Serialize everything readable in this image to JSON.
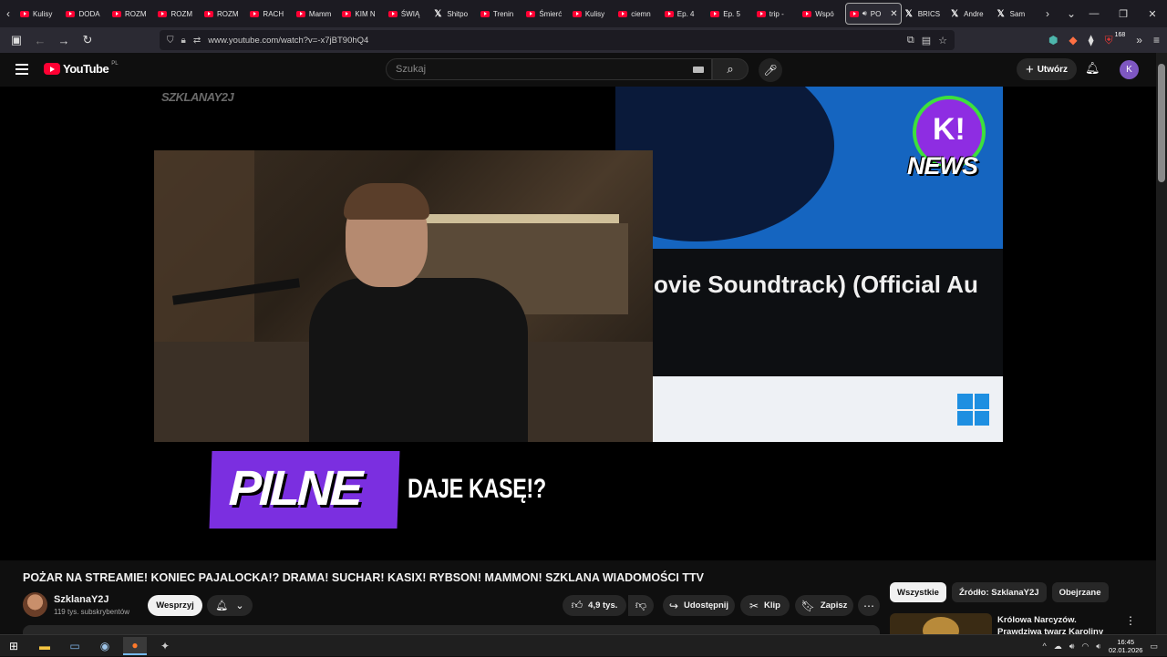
{
  "browser": {
    "tabs": [
      {
        "label": "Kulisy",
        "icon": "youtube-icon"
      },
      {
        "label": "DODA",
        "icon": "youtube-icon"
      },
      {
        "label": "ROZM",
        "icon": "youtube-icon"
      },
      {
        "label": "ROZM",
        "icon": "youtube-icon"
      },
      {
        "label": "ROZM",
        "icon": "youtube-icon"
      },
      {
        "label": "RACH",
        "icon": "youtube-icon"
      },
      {
        "label": "Mamm",
        "icon": "youtube-icon"
      },
      {
        "label": "KIM N",
        "icon": "youtube-icon"
      },
      {
        "label": "ŚWIĄ",
        "icon": "youtube-icon"
      },
      {
        "label": "Shitpo",
        "icon": "x-icon"
      },
      {
        "label": "Trenin",
        "icon": "youtube-icon"
      },
      {
        "label": "Śmierć",
        "icon": "youtube-icon"
      },
      {
        "label": "Kulisy",
        "icon": "youtube-icon"
      },
      {
        "label": "ciemn",
        "icon": "youtube-icon"
      },
      {
        "label": "Ep. 4",
        "icon": "youtube-icon"
      },
      {
        "label": "Ep. 5",
        "icon": "youtube-icon"
      },
      {
        "label": "trip -",
        "icon": "youtube-icon"
      },
      {
        "label": "Wspó",
        "icon": "youtube-icon"
      }
    ],
    "active_tab": {
      "label": "PO",
      "icon": "youtube-icon"
    },
    "tabs_after": [
      {
        "label": "BRICS",
        "icon": "x-icon"
      },
      {
        "label": "Andre",
        "icon": "x-icon"
      },
      {
        "label": "Sam",
        "icon": "x-icon"
      }
    ],
    "url": "www.youtube.com/watch?v=-x7jBT90hQ4",
    "extensions_badge": "168"
  },
  "youtube": {
    "logo_text": "YouTube",
    "country_code": "PL",
    "search_placeholder": "Szukaj",
    "create_label": "Utwórz",
    "avatar_letter": "K"
  },
  "video": {
    "watermark": "SZKLANAY2J",
    "screen_text": "ovie Soundtrack) (Official Au",
    "news_logo_text": "NEWS",
    "lower_third_label": "PILNE",
    "headline": "DAJE KASĘ!?"
  },
  "watch": {
    "title": "POŻAR NA STREAMIE! KONIEC PAJALOCKA!? DRAMA! SUCHAR! KASIX! RYBSON! MAMMON! SZKLANA WIADOMOŚCI TTV",
    "channel_name": "SzklanaY2J",
    "subscribers": "119 tys. subskrybentów",
    "support_label": "Wesprzyj",
    "likes": "4,9 tys.",
    "share_label": "Udostępnij",
    "clip_label": "Klip",
    "save_label": "Zapisz"
  },
  "sidebar": {
    "chips": [
      "Wszystkie",
      "Źródło: SzklanaY2J",
      "Obejrzane"
    ],
    "recommendation_title": "Królowa Narcyzów. Prawdziwa twarz Karoliny Pomarańskiej"
  },
  "taskbar": {
    "time": "16:45",
    "date": "02.01.2026"
  },
  "colors": {
    "youtube_red": "#ff0033",
    "lower_third_purple": "#7b2fe0",
    "background": "#0f0f0f"
  }
}
